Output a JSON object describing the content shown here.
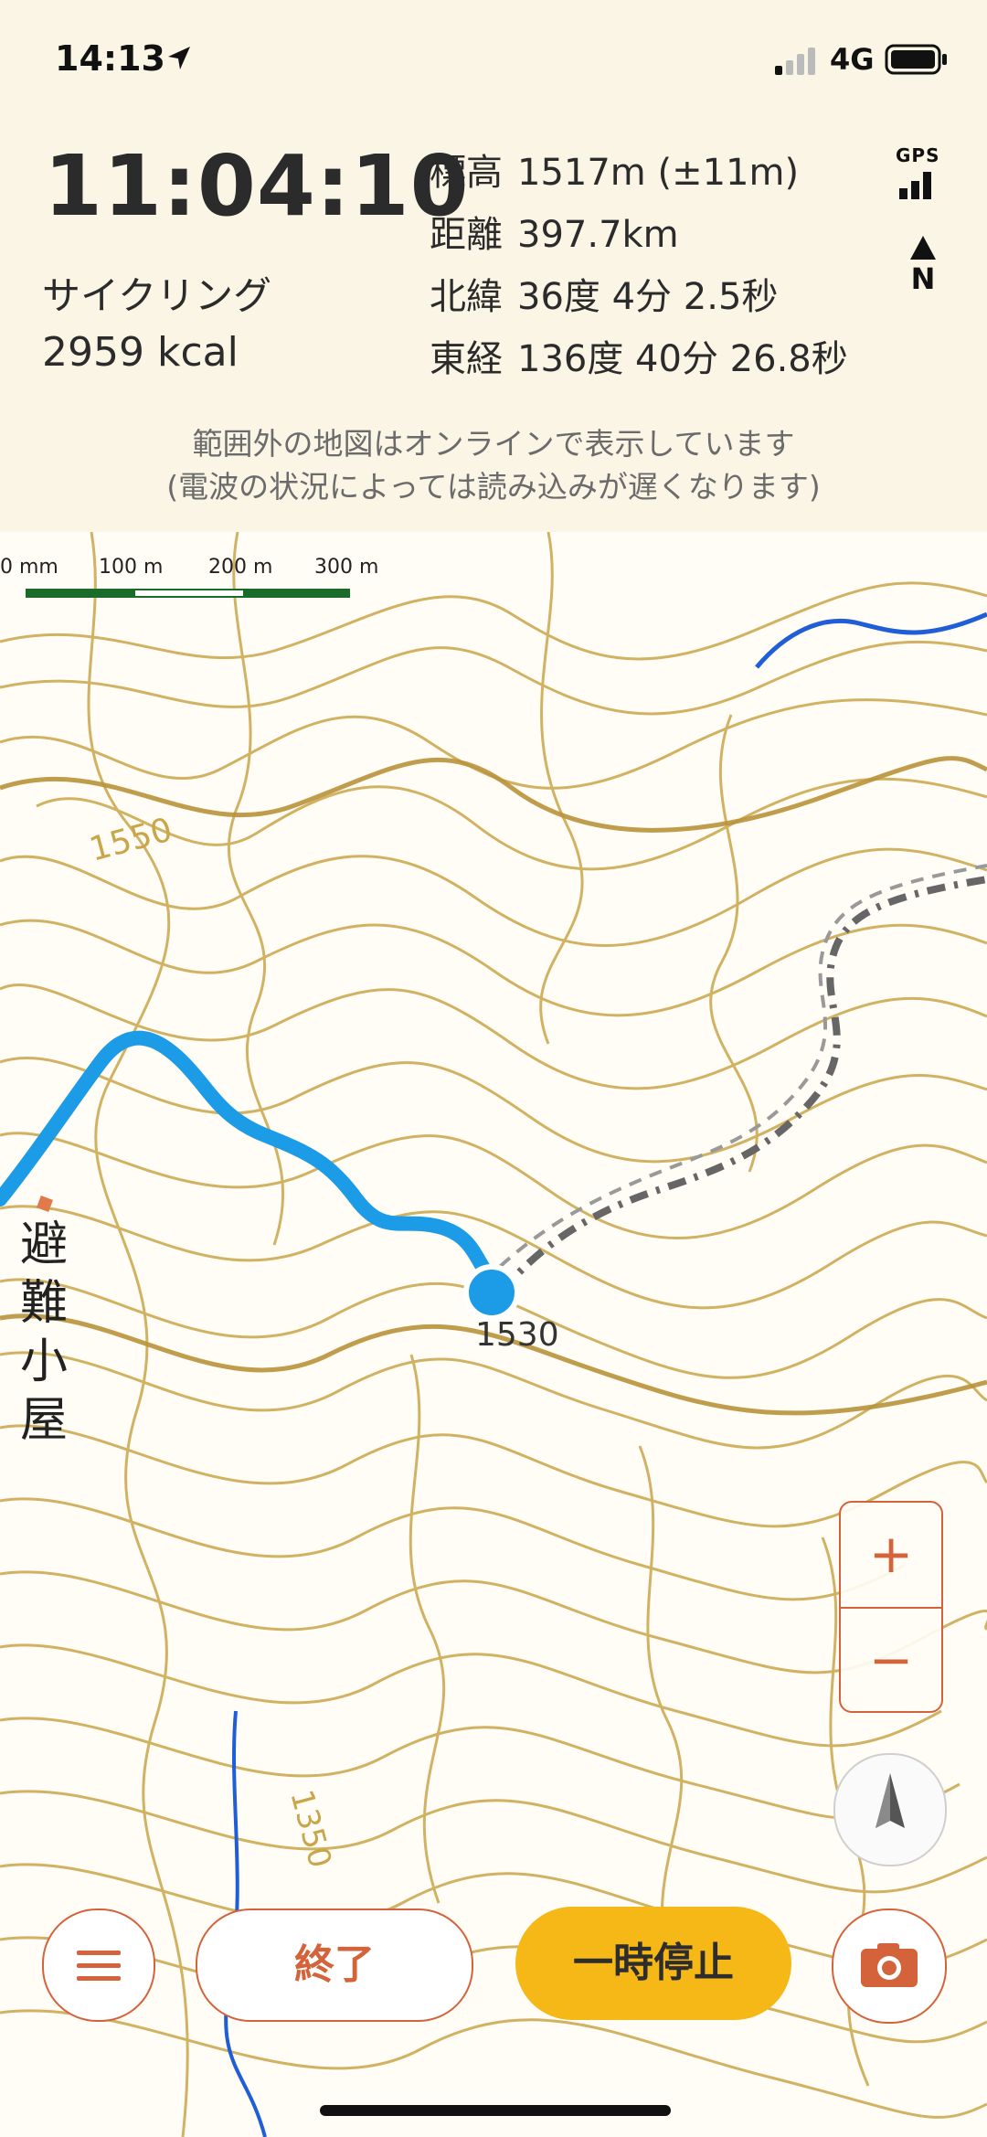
{
  "status_bar": {
    "time": "14:13",
    "network": "4G"
  },
  "tracker": {
    "elapsed": "11:04:10",
    "activity": "サイクリング",
    "calories": "2959 kcal",
    "stats": [
      {
        "label": "標高",
        "value": "1517m (±11m)"
      },
      {
        "label": "距離",
        "value": "397.7km"
      },
      {
        "label": "北緯",
        "value": "36度 4分 2.5秒"
      },
      {
        "label": "東経",
        "value": "136度 40分 26.8秒"
      }
    ],
    "gps_label": "GPS",
    "north_label": "N"
  },
  "notice": {
    "line1": "範囲外の地図はオンラインで表示しています",
    "line2": "(電波の状況によっては読み込みが遅くなります)"
  },
  "map": {
    "scale": [
      "0 mm",
      "100 m",
      "200 m",
      "300 m"
    ],
    "contour_labels": [
      "1550",
      "1530",
      "1350"
    ],
    "place_name": [
      "避",
      "難",
      "小",
      "屋"
    ],
    "colors": {
      "contour": "#c9a64a",
      "track": "#1c9be6",
      "river": "#1f5ed6",
      "road": "#666666"
    }
  },
  "controls": {
    "zoom_in": "+",
    "zoom_out": "−",
    "end": "終了",
    "pause": "一時停止"
  },
  "colors": {
    "accent": "#d4623a",
    "pause": "#f6b817",
    "header_bg": "#fbf5e6"
  }
}
